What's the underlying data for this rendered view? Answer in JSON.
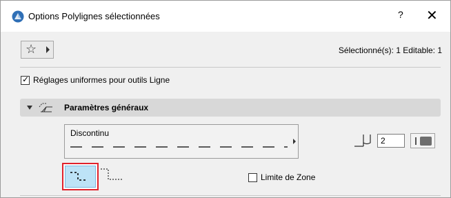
{
  "window": {
    "title": "Options Polylignes sélectionnées",
    "help_label": "?",
    "close_label": "✕"
  },
  "toolbar": {
    "favorites_icon": "star-icon",
    "selection_info": "Sélectionné(s): 1 Editable: 1"
  },
  "uniform_settings": {
    "label": "Réglages uniformes pour outils Ligne",
    "checked": true
  },
  "panel": {
    "title": "Paramètres généraux",
    "expanded": true
  },
  "line_type": {
    "name": "Discontinu"
  },
  "pen": {
    "number": "2",
    "color": "#6e6e6e"
  },
  "orientation": {
    "selected_index": 0
  },
  "zone_boundary": {
    "label": "Limite de Zone",
    "checked": false
  },
  "colors": {
    "selection_highlight": "#e0212b",
    "selected_fill": "#bde3f7"
  }
}
